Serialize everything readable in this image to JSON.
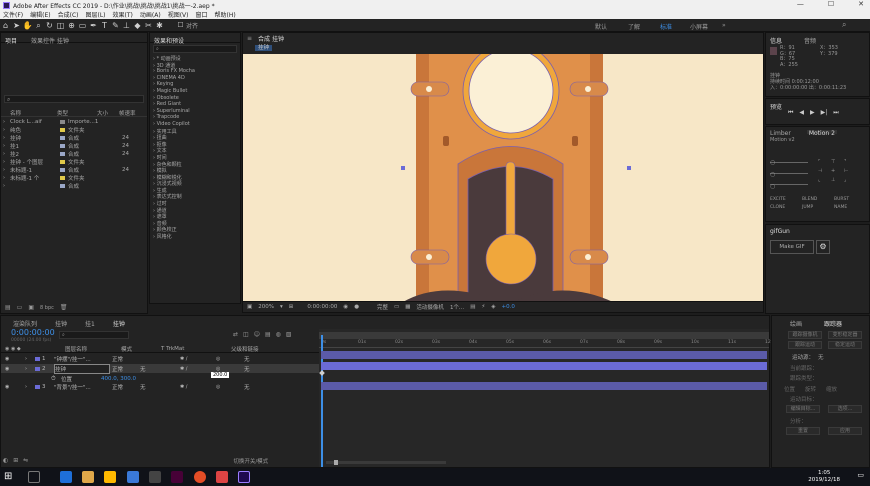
{
  "window": {
    "title": "Adobe After Effects CC 2019 - D:\\作业\\挑战\\挑战\\挑战1\\挑战一-2.aep *",
    "min": "—",
    "max": "☐",
    "close": "✕"
  },
  "menu": [
    "文件(F)",
    "编辑(E)",
    "合成(C)",
    "图层(L)",
    "效果(T)",
    "动画(A)",
    "视图(V)",
    "窗口",
    "帮助(H)"
  ],
  "toolbar": {
    "snap_label": "对齐",
    "workspaces": [
      "默认",
      "了解",
      "标准",
      "小屏幕"
    ],
    "search_icon": "search-icon"
  },
  "project": {
    "tab_project": "项目",
    "tab_effect_controls": "效果控件 挂钟",
    "search_placeholder": "⌕",
    "headers": [
      "名称",
      "类型",
      "大小",
      "帧速率"
    ],
    "items": [
      {
        "name": "Clock L...aif",
        "type": "Importe...1",
        "size": "",
        "fps": "",
        "color": "#8a8a8a"
      },
      {
        "name": "纯色",
        "type": "文件夹",
        "size": "",
        "fps": "",
        "color": "#e0c94a"
      },
      {
        "name": "挂钟",
        "type": "合成",
        "size": "",
        "fps": "24",
        "color": "#9aa7c7"
      },
      {
        "name": "挂1",
        "type": "合成",
        "size": "",
        "fps": "24",
        "color": "#9aa7c7"
      },
      {
        "name": "挂2",
        "type": "合成",
        "size": "",
        "fps": "24",
        "color": "#9aa7c7"
      },
      {
        "name": "挂钟 - 个图层",
        "type": "文件夹",
        "size": "",
        "fps": "",
        "color": "#e0c94a"
      },
      {
        "name": "未标题-1",
        "type": "合成",
        "size": "",
        "fps": "24",
        "color": "#9aa7c7"
      },
      {
        "name": "未标题-1 个",
        "type": "文件夹",
        "size": "",
        "fps": "",
        "color": "#e0c94a"
      },
      {
        "name": "",
        "type": "合成",
        "size": "",
        "fps": "",
        "color": "#9aa7c7"
      }
    ],
    "bpc": "8 bpc"
  },
  "effects": {
    "tab": "效果和预设",
    "list": [
      "* 动画预设",
      "3D 通道",
      "Boris FX Mocha",
      "CINEMA 4D",
      "Keying",
      "Magic Bullet",
      "Obsolete",
      "Red Giant",
      "Superluminal",
      "Trapcode",
      "Video Copilot",
      "实用工具",
      "扭曲",
      "抠像",
      "文本",
      "时间",
      "杂色和颗粒",
      "模拟",
      "模糊和锐化",
      "沉浸式视频",
      "生成",
      "表达式控制",
      "过时",
      "通道",
      "遮罩",
      "音频",
      "颜色校正",
      "风格化"
    ]
  },
  "composition": {
    "tab": "合成 挂钟",
    "breadcrumb": "挂钟",
    "zoom": "200%",
    "time": "0:00:00:00",
    "quality": "完整",
    "camera": "活动摄像机",
    "views": "1个...",
    "exposure": "+0.0",
    "colors": {
      "bg": "#f7e7c7",
      "wood": "#c9763a",
      "wood_light": "#e0904a",
      "dark": "#4a3a3c",
      "gold": "#f0a73c",
      "cream": "#fbf0d6"
    }
  },
  "info": {
    "tab_info": "信息",
    "tab_audio": "音频",
    "r": "R：91",
    "g": "G：67",
    "b": "B：75",
    "a": "A：255",
    "x": "X：353",
    "y": "Y：379",
    "layer": "挂钟",
    "duration": "持续时间 0:00:12:00",
    "in_out": "入：0:00:00:00  出：0:00:11:23"
  },
  "preview": {
    "tab": "预览"
  },
  "limber": {
    "tab_limber": "Limber",
    "tab_motion": "Motion 2",
    "version": "Motion v2",
    "labels": [
      "EXCITE",
      "BLEND",
      "BURST",
      "CLONE",
      "JUMP",
      "NAME"
    ]
  },
  "gifgun": {
    "tab": "gifGun",
    "button": "Make GIF"
  },
  "timeline": {
    "tabs": [
      "渲染队列",
      "挂钟",
      "挂1",
      "挂钟"
    ],
    "timecode": "0:00:00:00",
    "timecode_sub": "00000 (24.00 fps)",
    "headers": [
      "图层名称",
      "模式",
      "T TrkMat",
      "父级和链接"
    ],
    "layers": [
      {
        "num": "1",
        "name": "\"钟摆\"/挂一\"...",
        "mode": "正常",
        "trk": "",
        "parent": "无",
        "color": "#6b6bd6"
      },
      {
        "num": "2",
        "name": "挂钟",
        "mode": "正常",
        "trk": "无",
        "parent": "无",
        "color": "#6b6bd6"
      },
      {
        "num": "",
        "name": "位置",
        "mode": "",
        "trk": "",
        "parent": "",
        "color": ""
      },
      {
        "num": "3",
        "name": "\"背景\"/挂一\"...",
        "mode": "正常",
        "trk": "无",
        "parent": "无",
        "color": "#6b6bd6"
      }
    ],
    "position_value": "400.0, 300.0",
    "tooltip": "200.0",
    "ticks": [
      "0s",
      "01s",
      "02s",
      "03s",
      "04s",
      "05s",
      "06s",
      "07s",
      "08s",
      "09s",
      "10s",
      "11s",
      "12s"
    ],
    "switch_label": "切换开关/模式"
  },
  "rightbottom": {
    "tab_draw": "绘画",
    "tab_tracker": "跟踪器",
    "btns": [
      "跟踪摄像机",
      "变形稳定器",
      "跟踪运动",
      "稳定运动"
    ],
    "motion_source": "运动源：",
    "motion_source_val": "无",
    "current_track": "当前跟踪：",
    "track_type": "跟踪类型：",
    "checks": [
      "位置",
      "旋转",
      "缩放"
    ],
    "target": "运动目标：",
    "edit_target": "编辑目标...",
    "options": "选项...",
    "analyze": "分析：",
    "reset": "重置",
    "apply": "应用"
  },
  "taskbar": {
    "time": "1:05",
    "date": "2019/12/18"
  }
}
